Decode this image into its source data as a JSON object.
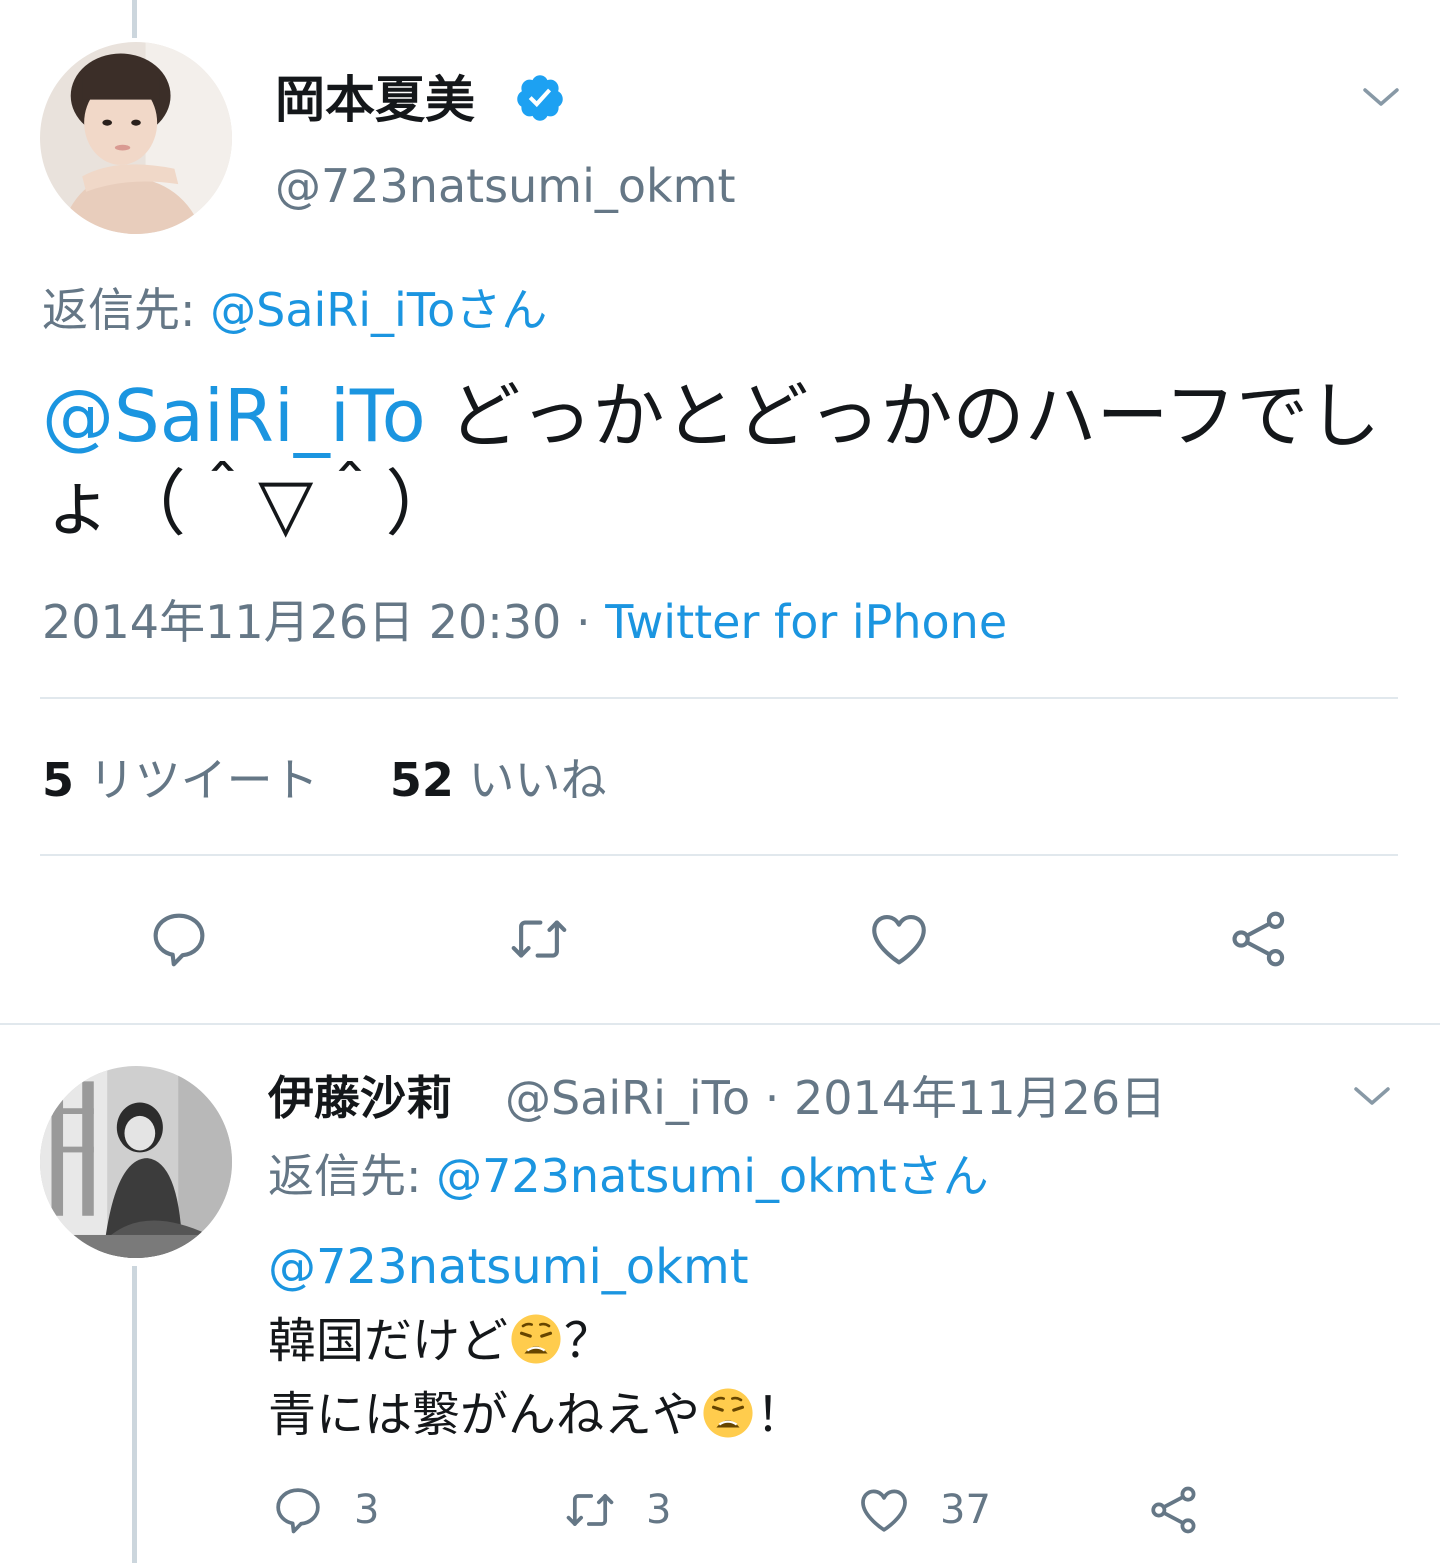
{
  "tweet": {
    "author_name": "岡本夏美",
    "author_handle": "@723natsumi_okmt",
    "reply_prefix": "返信先: ",
    "reply_to": "@SaiRi_iToさん",
    "mention": "@SaiRi_iTo",
    "text_after_mention": " どっかとどっかのハーフでしょ（＾▽＾）",
    "timestamp": "2014年11月26日 20:30",
    "separator": " · ",
    "source": "Twitter for iPhone",
    "retweet_count": "5",
    "retweet_label": "リツイート",
    "like_count": "52",
    "like_label": "いいね"
  },
  "reply": {
    "author_name": "伊藤沙莉",
    "header_meta": "@SaiRi_iTo · 2014年11月26日",
    "reply_prefix": "返信先: ",
    "reply_to": "@723natsumi_okmtさん",
    "mention": "@723natsumi_okmt",
    "line1": "韓国だけど",
    "line1_end": "？",
    "line2": "青には繋がんねえや",
    "line2_end": "！",
    "reply_count": "3",
    "retweet_count": "3",
    "like_count": "37"
  },
  "colors": {
    "link": "#1b95e0",
    "secondary": "#657786",
    "divider": "#e1e8ed",
    "verified": "#1da1f2"
  },
  "icons": [
    "verified-badge-icon",
    "chevron-down-icon",
    "reply-icon",
    "retweet-icon",
    "like-icon",
    "share-icon",
    "weary-face-emoji"
  ]
}
